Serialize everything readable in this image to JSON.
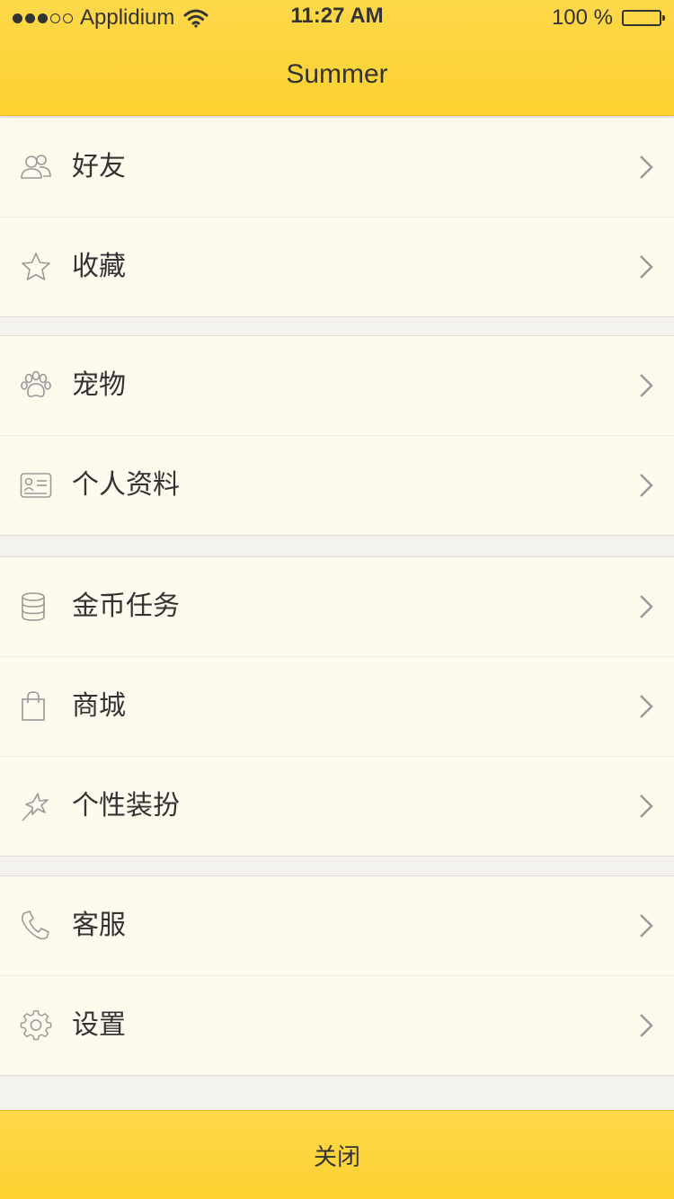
{
  "status_bar": {
    "carrier": "Applidium",
    "time": "11:27 AM",
    "battery": "100 %"
  },
  "header": {
    "title": "Summer"
  },
  "menu": {
    "friends": {
      "label": "好友",
      "icon": "friends-icon"
    },
    "favorites": {
      "label": "收藏",
      "icon": "star-icon"
    },
    "pets": {
      "label": "宠物",
      "icon": "paw-icon"
    },
    "profile": {
      "label": "个人资料",
      "icon": "id-card-icon"
    },
    "coin_tasks": {
      "label": "金币任务",
      "icon": "coins-icon"
    },
    "store": {
      "label": "商城",
      "icon": "shopping-bag-icon"
    },
    "dress_up": {
      "label": "个性装扮",
      "icon": "sparkle-star-icon"
    },
    "support": {
      "label": "客服",
      "icon": "phone-icon"
    },
    "settings": {
      "label": "设置",
      "icon": "gear-icon"
    }
  },
  "footer": {
    "close_label": "关闭"
  },
  "colors": {
    "accent": "#fcd130",
    "row_background": "#fefbee",
    "page_background": "#f3f2ef"
  }
}
